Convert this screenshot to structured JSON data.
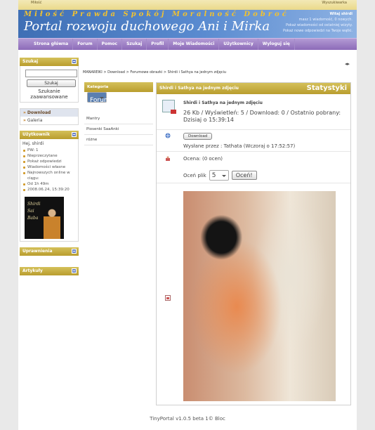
{
  "top": {
    "left": "Miłość",
    "right": "Wyszukiwarka"
  },
  "header": {
    "motto": "Miłość Prawda Spokój Moralność Dobroć",
    "title": "Portal rozwoju duchowego Ani i Mirka",
    "user_greeting": "Witaj shirdi",
    "user_line2": "masz 1 wiadomość, 0 nowych.",
    "user_line3": "Pokaż wiadomości od ostatniej wizyty.",
    "user_line4": "Pokaż nowe odpowiedzi na Twoje wątki."
  },
  "nav": [
    "Strona główna",
    "Forum",
    "Pomoc",
    "Szukaj",
    "Profil",
    "Moje Wiadomości",
    "Użytkownicy",
    "Wyloguj się"
  ],
  "sidebar": {
    "search_title": "Szukaj",
    "search_button": "Szukaj",
    "advanced": "Szukanie zaawansowane",
    "menu": [
      {
        "label": "Download",
        "active": true
      },
      {
        "label": "Galeria",
        "active": false
      }
    ],
    "user_title": "Użytkownik",
    "hello": "Hej, shirdi",
    "user_items": [
      "PW: 1",
      "Nieprzeczytane",
      "Pokaż odpowiedzi",
      "Wiadomości własne",
      "Najnowszych online w ciągu:",
      "Od 1h 49m",
      "2008.06.24, 15:39:20"
    ],
    "avatar_text1": "Shirdi",
    "avatar_text2": "Sai",
    "avatar_text3": "Baba",
    "perms_title": "Uprawnienia",
    "articles_title": "Artykuły"
  },
  "breadcrumb": "MANAREIKI > Download > Forumowe obrazki > Shirdi i Sathya na jednym zdjęciu",
  "categories": {
    "title": "Kategoria",
    "items": [
      {
        "label": "Forumowe obrazki",
        "selected": true
      },
      {
        "label": "Mantry",
        "selected": false
      },
      {
        "label": "Piosenki SaaAnki",
        "selected": false
      },
      {
        "label": "różne",
        "selected": false
      }
    ]
  },
  "content": {
    "header_title": "Shirdi i Sathya na jednym zdjęciu",
    "stats_label": "Statystyki",
    "file_title": "Shirdi i Sathya na jednym zdjęciu",
    "file_info": "26 Kb / Wyświetleń: 5 / Download: 0 / Ostatnio pobrany: Dzisiaj o 15:39:14",
    "download_button": "Download",
    "uploaded_by": "Wysłane przez : Tathata (Wczoraj o 17:52:57)",
    "rating": "Ocena: (0 ocen)",
    "rate_label": "Oceń plik",
    "rate_value": "5",
    "rate_button": "Oceń!"
  },
  "footer": "TinyPortal v1.0.5 beta 1© Bloc"
}
